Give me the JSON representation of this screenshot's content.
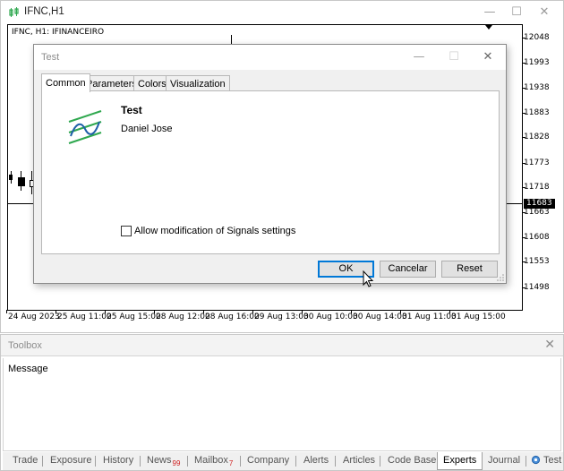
{
  "chart_window": {
    "title": "IFNC,H1",
    "symbol_label": "IFNC, H1:  IFINANCEIRO",
    "price_ticks": [
      "12048",
      "11993",
      "11938",
      "11883",
      "11828",
      "11773",
      "11718",
      "11663",
      "11608",
      "11553",
      "11498"
    ],
    "current_price": "11683",
    "time_ticks": [
      "24 Aug 2023",
      "25 Aug 11:00",
      "25 Aug 15:00",
      "28 Aug 12:00",
      "28 Aug 16:00",
      "29 Aug 13:00",
      "30 Aug 10:00",
      "30 Aug 14:00",
      "31 Aug 11:00",
      "31 Aug 15:00"
    ],
    "controls": {
      "minimize": "—",
      "maximize": "☐",
      "close": "✕"
    }
  },
  "dialog": {
    "title": "Test",
    "controls": {
      "minimize": "—",
      "maximize": "☐",
      "close": "✕"
    },
    "tabs": [
      "Common",
      "Parameters",
      "Colors",
      "Visualization"
    ],
    "active_tab": "Common",
    "expert_name": "Test",
    "author": "Daniel Jose",
    "allow_signals_label": "Allow modification of Signals settings",
    "allow_signals_checked": false,
    "buttons": {
      "ok": "OK",
      "cancel": "Cancelar",
      "reset": "Reset"
    },
    "icon_color": "#2fa84f"
  },
  "toolbox": {
    "title": "Toolbox",
    "close": "✕",
    "column_header": "Message",
    "tabs": [
      {
        "label": "Trade"
      },
      {
        "label": "Exposure"
      },
      {
        "label": "History"
      },
      {
        "label": "News",
        "badge": "99"
      },
      {
        "label": "Mailbox",
        "badge": "7"
      },
      {
        "label": "Company"
      },
      {
        "label": "Alerts"
      },
      {
        "label": "Articles"
      },
      {
        "label": "Code Base"
      },
      {
        "label": "Experts",
        "active": true
      },
      {
        "label": "Journal"
      },
      {
        "label": "Test",
        "icon": "gear-icon"
      }
    ]
  }
}
